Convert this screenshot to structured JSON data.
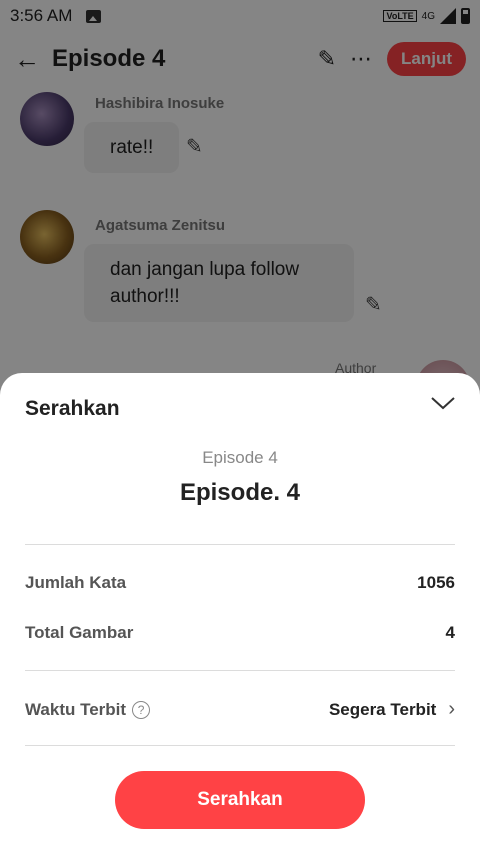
{
  "status_bar": {
    "time": "3:56 AM",
    "volte": "VoLTE",
    "network": "4G"
  },
  "app_bar": {
    "title": "Episode 4",
    "next_label": "Lanjut"
  },
  "chat": {
    "messages": [
      {
        "name": "Hashibira Inosuke",
        "text": "rate!!"
      },
      {
        "name": "Agatsuma Zenitsu",
        "text": "dan jangan lupa follow author!!!"
      }
    ],
    "author_label": "Author"
  },
  "sheet": {
    "header": "Serahkan",
    "episode_sub": "Episode 4",
    "episode_title": "Episode. 4",
    "rows": [
      {
        "label": "Jumlah Kata",
        "value": "1056"
      },
      {
        "label": "Total Gambar",
        "value": "4"
      }
    ],
    "publish": {
      "label": "Waktu Terbit",
      "help": "?",
      "value": "Segera Terbit"
    },
    "submit_label": "Serahkan"
  },
  "colors": {
    "accent": "#ff4245",
    "overlay": "rgba(0,0,0,0.48)"
  },
  "icons": [
    "back-arrow-icon",
    "pencil-icon",
    "more-icon",
    "gallery-icon",
    "signal-icon",
    "battery-icon",
    "chevron-down-icon",
    "help-icon",
    "chevron-right-icon"
  ]
}
